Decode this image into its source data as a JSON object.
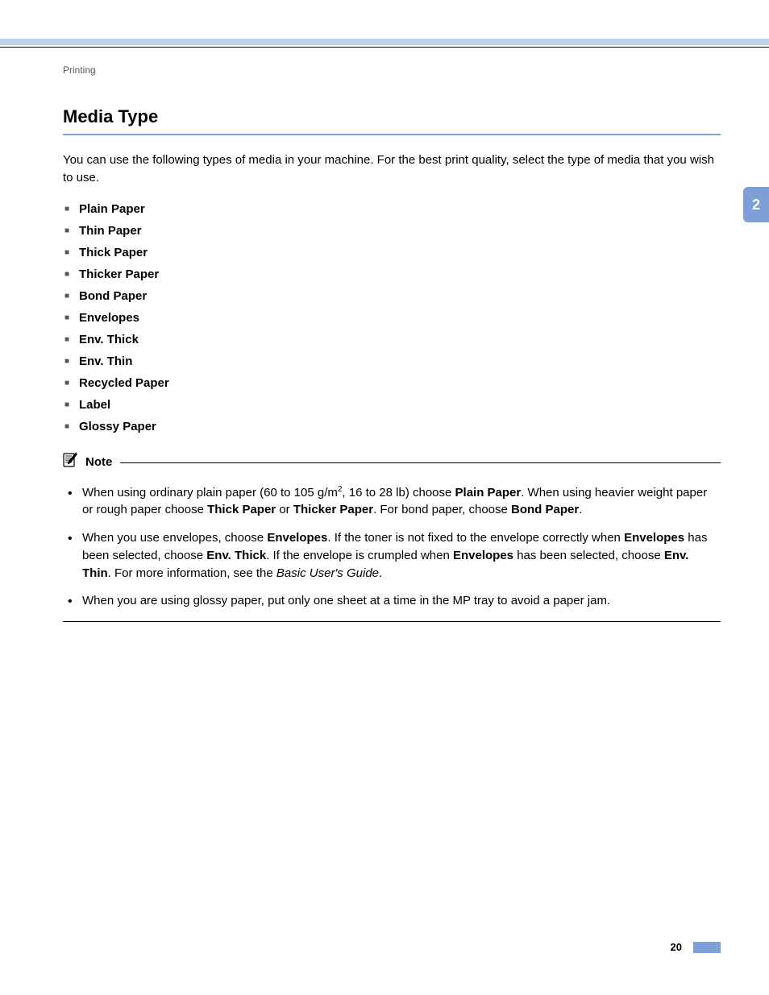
{
  "section_label": "Printing",
  "heading": "Media Type",
  "intro": "You can use the following types of media in your machine. For the best print quality, select the type of media that you wish to use.",
  "media_types": [
    "Plain Paper",
    "Thin Paper",
    "Thick Paper",
    "Thicker Paper",
    "Bond Paper",
    "Envelopes",
    "Env. Thick",
    "Env. Thin",
    "Recycled Paper",
    "Label",
    "Glossy Paper"
  ],
  "note_title": "Note",
  "notes": [
    {
      "html": "When using ordinary plain paper (60 to 105 g/m<sup>2</sup>, 16 to 28 lb) choose <b>Plain Paper</b>. When using heavier weight paper or rough paper choose <b>Thick Paper</b> or <b>Thicker Paper</b>. For bond paper, choose <b>Bond Paper</b>."
    },
    {
      "html": "When you use envelopes, choose <b>Envelopes</b>. If the toner is not fixed to the envelope correctly when <b>Envelopes</b> has been selected, choose <b>Env. Thick</b>. If the envelope is crumpled when <b>Envelopes</b> has been selected, choose <b>Env. Thin</b>. For more information, see the <i>Basic User's Guide</i>."
    },
    {
      "html": "When you are using glossy paper, put only one sheet at a time in the MP tray to avoid a paper jam."
    }
  ],
  "chapter_tab": "2",
  "page_number": "20"
}
